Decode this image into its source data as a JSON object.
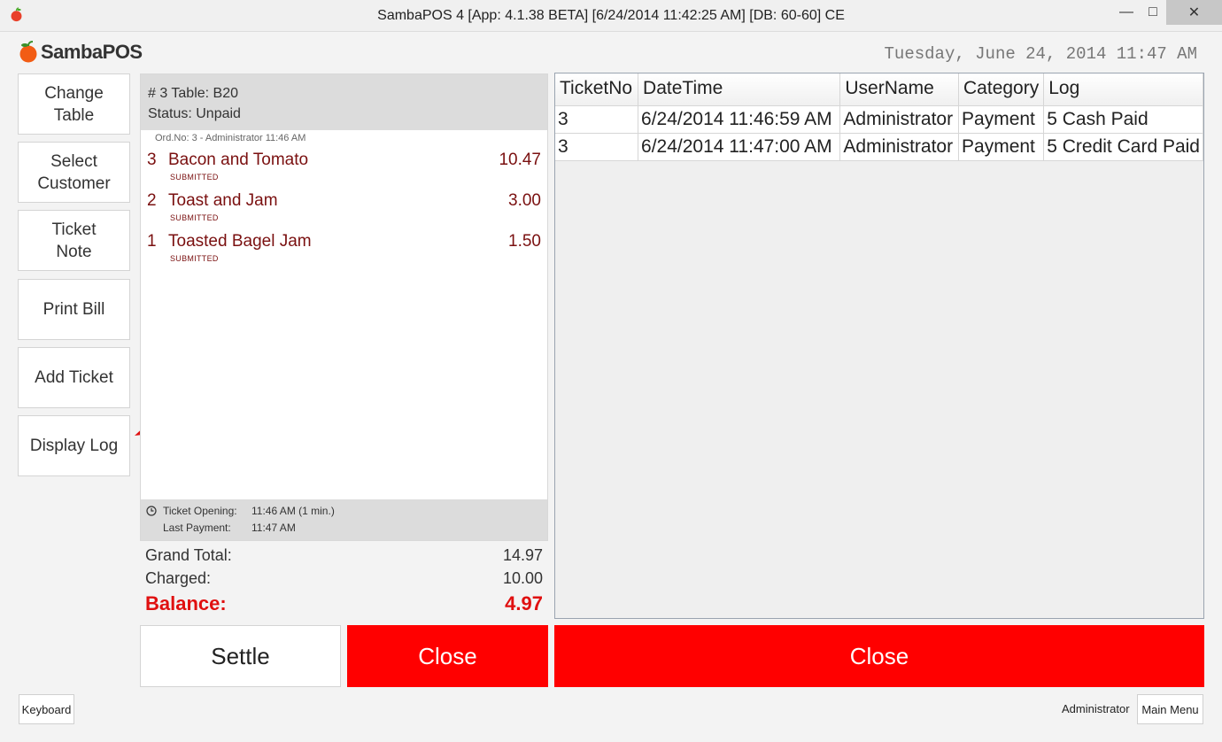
{
  "window": {
    "title": "SambaPOS 4 [App: 4.1.38 BETA] [6/24/2014 11:42:25 AM] [DB: 60-60] CE",
    "minimize_glyph": "—",
    "maximize_glyph": "□",
    "close_glyph": "✕"
  },
  "header": {
    "logo_text": "SambaPOS",
    "clock": "Tuesday, June 24, 2014 11:47 AM"
  },
  "commands": [
    {
      "label": "Change\nTable"
    },
    {
      "label": "Select\nCustomer"
    },
    {
      "label": "Ticket\nNote"
    },
    {
      "label": "Print Bill"
    },
    {
      "label": "Add Ticket"
    },
    {
      "label": "Display Log"
    }
  ],
  "ticket": {
    "header_line": "# 3 Table: B20",
    "status_line": "Status: Unpaid",
    "order_meta": "Ord.No: 3 - Administrator  11:46 AM",
    "orders": [
      {
        "qty": "3",
        "name": "Bacon and Tomato",
        "price": "10.47",
        "state": "SUBMITTED"
      },
      {
        "qty": "2",
        "name": "Toast and Jam",
        "price": "3.00",
        "state": "SUBMITTED"
      },
      {
        "qty": "1",
        "name": "Toasted Bagel Jam",
        "price": "1.50",
        "state": "SUBMITTED"
      }
    ],
    "footer": {
      "opening_label": "Ticket Opening:",
      "opening_value": "11:46 AM (1 min.)",
      "payment_label": "Last Payment:",
      "payment_value": "11:47 AM"
    }
  },
  "totals": {
    "grand_total_label": "Grand Total:",
    "grand_total": "14.97",
    "charged_label": "Charged:",
    "charged": "10.00",
    "balance_label": "Balance:",
    "balance": "4.97"
  },
  "actions": {
    "settle": "Settle",
    "close": "Close",
    "close_log": "Close"
  },
  "log": {
    "columns": [
      "TicketNo",
      "DateTime",
      "UserName",
      "Category",
      "Log"
    ],
    "rows": [
      [
        "3",
        "6/24/2014 11:46:59 AM",
        "Administrator",
        "Payment",
        "5 Cash Paid"
      ],
      [
        "3",
        "6/24/2014 11:47:00 AM",
        "Administrator",
        "Payment",
        "5 Credit Card Paid"
      ]
    ]
  },
  "footer": {
    "keyboard": "Keyboard",
    "user": "Administrator",
    "main_menu": "Main Menu"
  },
  "colors": {
    "accent_red": "#ff0000",
    "balance_red": "#e01010",
    "order_text": "#7a1010"
  }
}
